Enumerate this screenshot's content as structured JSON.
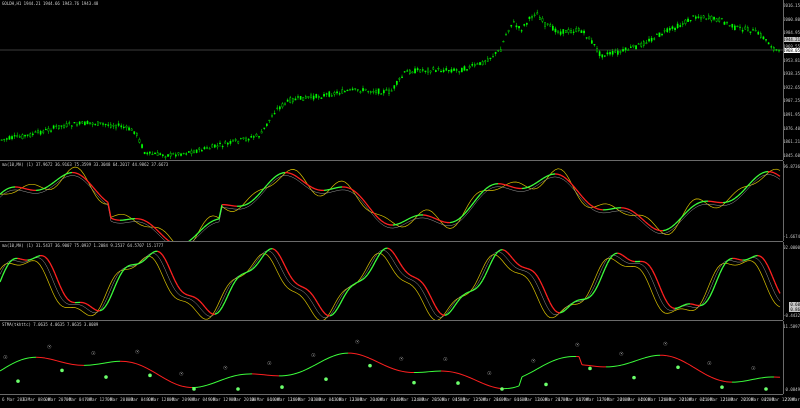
{
  "panes": {
    "main": {
      "label": "GOLDH,H1 1944.21 1944.66 1943.76 1943.48",
      "yticks": [
        "2016.15",
        "2000.80",
        "1984.95",
        "1969.55",
        "1953.81",
        "1938.35",
        "1922.65",
        "1907.25",
        "1891.95",
        "1876.40",
        "1861.21",
        "1845.60"
      ],
      "price_tag": "1944.21",
      "price_tag_upper": "1968.05"
    },
    "osc1": {
      "label": "ma(10,MA) (1) 37.9672 36.9163 75.3599 33.3048 64.2017 44.9862 37.6673",
      "yticks": [
        "96.8736",
        "",
        "",
        "",
        "-1.6674"
      ]
    },
    "osc2": {
      "label": "ma(10,MA) (1) 31.5437 36.9007 75.0937 1.2084 9.2537 64.5707 15.1777",
      "yticks": [
        "102.0000",
        "",
        "",
        "",
        "-0.4432"
      ],
      "tags": [
        "0.60",
        "0.86"
      ]
    },
    "osc3": {
      "label": "STMA(tkhttc) 7.0635 4.0635 7.0635 3.0089",
      "yticks": [
        "11.5897",
        "0.0849"
      ]
    }
  },
  "xaxis": [
    "6 Mar 2023",
    "6 Mar 08:00",
    "6 Mar 20:00",
    "7 Mar 04:00",
    "7 Mar 12:00",
    "7 Mar 20:00",
    "8 Mar 04:00",
    "8 Mar 12:00",
    "8 Mar 20:00",
    "9 Mar 04:00",
    "9 Mar 12:00",
    "9 Mar 20:00",
    "10 Mar 04:00",
    "10 Mar 12:00",
    "10 Mar 20:00",
    "13 Mar 04:00",
    "13 Mar 12:00",
    "13 Mar 20:00",
    "14 Mar 04:00",
    "14 Mar 12:00",
    "14 Mar 20:00",
    "15 Mar 04:00",
    "15 Mar 12:00",
    "15 Mar 20:00",
    "16 Mar 04:00",
    "16 Mar 12:00",
    "16 Mar 20:00",
    "17 Mar 04:00",
    "17 Mar 12:00",
    "17 Mar 20:00",
    "20 Mar 04:00",
    "20 Mar 12:00",
    "20 Mar 20:00",
    "21 Mar 04:00",
    "21 Mar 12:00",
    "21 Mar 20:00",
    "22 Mar 04:00",
    "22 Mar 12:00",
    "22 Mar 20:00"
  ],
  "colors": {
    "bg": "#000000",
    "candle": "#00ff00",
    "red": "#ff2020",
    "green": "#3cff3c",
    "yellow": "#d8c000",
    "gray": "#9a9a9a",
    "violet": "#c040ff"
  }
}
